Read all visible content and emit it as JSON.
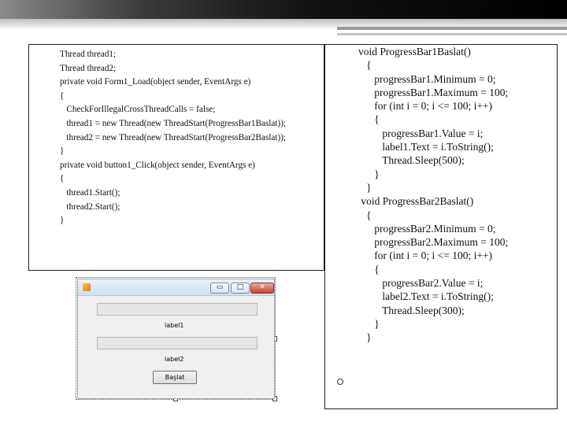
{
  "left_code": [
    "Thread thread1;",
    "Thread thread2;",
    "private void Form1_Load(object sender, EventArgs e)",
    "{",
    "   CheckForIllegalCrossThreadCalls = false;",
    "",
    "   thread1 = new Thread(new ThreadStart(ProgressBar1Baslat));",
    "   thread2 = new Thread(new ThreadStart(ProgressBar2Baslat));",
    "}",
    "private void button1_Click(object sender, EventArgs e)",
    "{",
    "   thread1.Start();",
    "   thread2.Start();",
    "}"
  ],
  "right_code": [
    "void ProgressBar1Baslat()",
    "   {",
    "      progressBar1.Minimum = 0;",
    "      progressBar1.Maximum = 100;",
    "",
    "      for (int i = 0; i <= 100; i++)",
    "      {",
    "         progressBar1.Value = i;",
    "         label1.Text = i.ToString();",
    "         Thread.Sleep(500);",
    "      }",
    "   }",
    " void ProgressBar2Baslat()",
    "   {",
    "      progressBar2.Minimum = 0;",
    "      progressBar2.Maximum = 100;",
    "",
    "      for (int i = 0; i <= 100; i++)",
    "      {",
    "         progressBar2.Value = i;",
    "         label2.Text = i.ToString();",
    "         Thread.Sleep(300);",
    "      }",
    "   }"
  ],
  "form": {
    "icon": "app-icon",
    "minimize_glyph": "▭",
    "maximize_glyph": "□",
    "close_glyph": "✕",
    "label1": "label1",
    "label2": "label2",
    "start_button": "Başlat",
    "progress1_value": 0,
    "progress2_value": 0
  },
  "colors": {
    "topbar": "#000000",
    "border": "#222222"
  }
}
